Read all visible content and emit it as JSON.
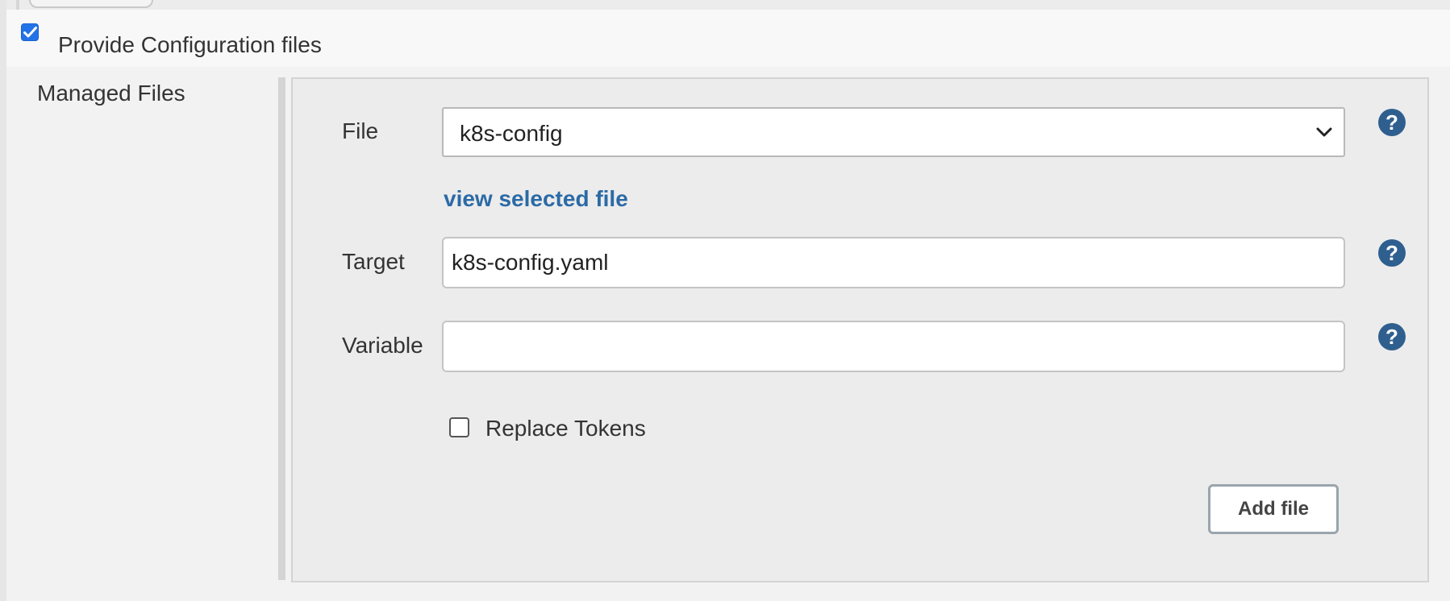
{
  "config": {
    "checked": true,
    "label": "Provide Configuration files"
  },
  "section": {
    "label": "Managed Files"
  },
  "form": {
    "file": {
      "label": "File",
      "selected": "k8s-config"
    },
    "view_link": "view selected file",
    "target": {
      "label": "Target",
      "value": "k8s-config.yaml"
    },
    "variable": {
      "label": "Variable",
      "value": ""
    },
    "replace_tokens": {
      "label": "Replace Tokens",
      "checked": false
    },
    "add_button": "Add file",
    "help_glyph": "?"
  },
  "colors": {
    "link": "#2b6aa6",
    "help_icon": "#2f5f8f",
    "checkbox_checked": "#2372e8"
  },
  "icons": {
    "checkbox_checked": "checkmark-icon",
    "select": "chevron-down-icon",
    "help": "help-icon"
  }
}
